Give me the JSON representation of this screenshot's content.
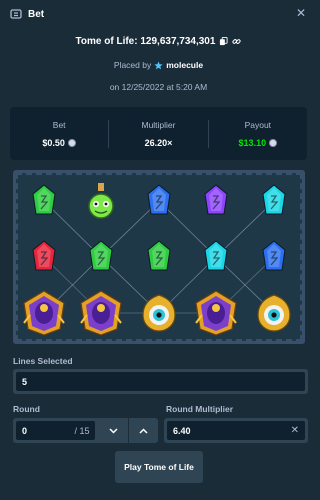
{
  "header": {
    "title": "Bet",
    "close_icon": "close-icon"
  },
  "game": {
    "title": "Tome of Life: 129,637,734,301"
  },
  "placed": {
    "prefix": "Placed by",
    "user": "molecule"
  },
  "date": "on 12/25/2022 at 5:20 AM",
  "stats": {
    "bet_label": "Bet",
    "bet_value": "$0.50",
    "multiplier_label": "Multiplier",
    "multiplier_value": "26.20×",
    "payout_label": "Payout",
    "payout_value": "$13.10"
  },
  "board": {
    "rows": [
      [
        "green-rune",
        "green-potion",
        "blue-rune",
        "purple-rune",
        "cyan-rune"
      ],
      [
        "red-rune",
        "green-rune",
        "green-rune",
        "cyan-rune",
        "blue-rune"
      ],
      [
        "scarab-wild",
        "scarab-wild",
        "eye-amulet",
        "scarab-wild",
        "eye-amulet"
      ]
    ]
  },
  "lines": {
    "label": "Lines Selected",
    "value": "5"
  },
  "round": {
    "label": "Round",
    "value": "0",
    "total": "/ 15"
  },
  "round_multiplier": {
    "label": "Round Multiplier",
    "value": "6.40"
  },
  "play_button": "Play Tome of Life",
  "colors": {
    "bg": "#1a2c38",
    "panel": "#0f212e",
    "input": "#2f4553",
    "payout": "#00e701",
    "muted": "#b1bad3"
  }
}
